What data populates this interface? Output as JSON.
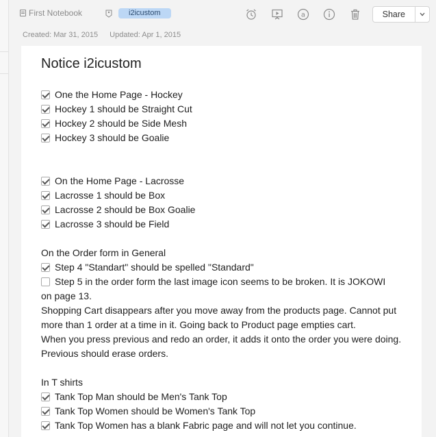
{
  "header": {
    "notebook": "First Notebook",
    "tag": "i2icustom",
    "share_label": "Share"
  },
  "meta": {
    "created": "Created: Mar 31, 2015",
    "updated": "Updated: Apr 1, 2015"
  },
  "note": {
    "title": "Notice i2icustom",
    "hockey": [
      "One the Home Page - Hockey",
      "Hockey 1 should be Straight Cut",
      "Hockey 2 should be Side Mesh",
      "Hockey 3 should be Goalie"
    ],
    "lacrosse": [
      "On the Home Page - Lacrosse",
      "Lacrosse 1 should be Box",
      "Lacrosse 2 should be Box Goalie",
      "Lacrosse 3 should be Field"
    ],
    "order_heading": "On the Order form in General",
    "order_step4": "Step 4 \"Standart\" should be spelled \"Standard\"",
    "order_step5_a": "Step 5 in the order form the last image icon seems to be broken. It is JOKOWI",
    "order_step5_b": "on page 13.",
    "cart_text": "Shopping Cart disappears after you move away from the products page. Cannot put more than 1 order at a time in it. Going back to Product page empties cart.",
    "previous_text": "When you press previous and redo an order, it adds it onto the order you were doing. Previous should erase orders.",
    "tshirts_heading": "In T shirts",
    "tshirts": [
      "Tank Top Man should be Men's Tank Top",
      "Tank Top Women should be Women's Tank Top",
      "Tank Top Women has a blank Fabric page and will not let you continue."
    ]
  }
}
